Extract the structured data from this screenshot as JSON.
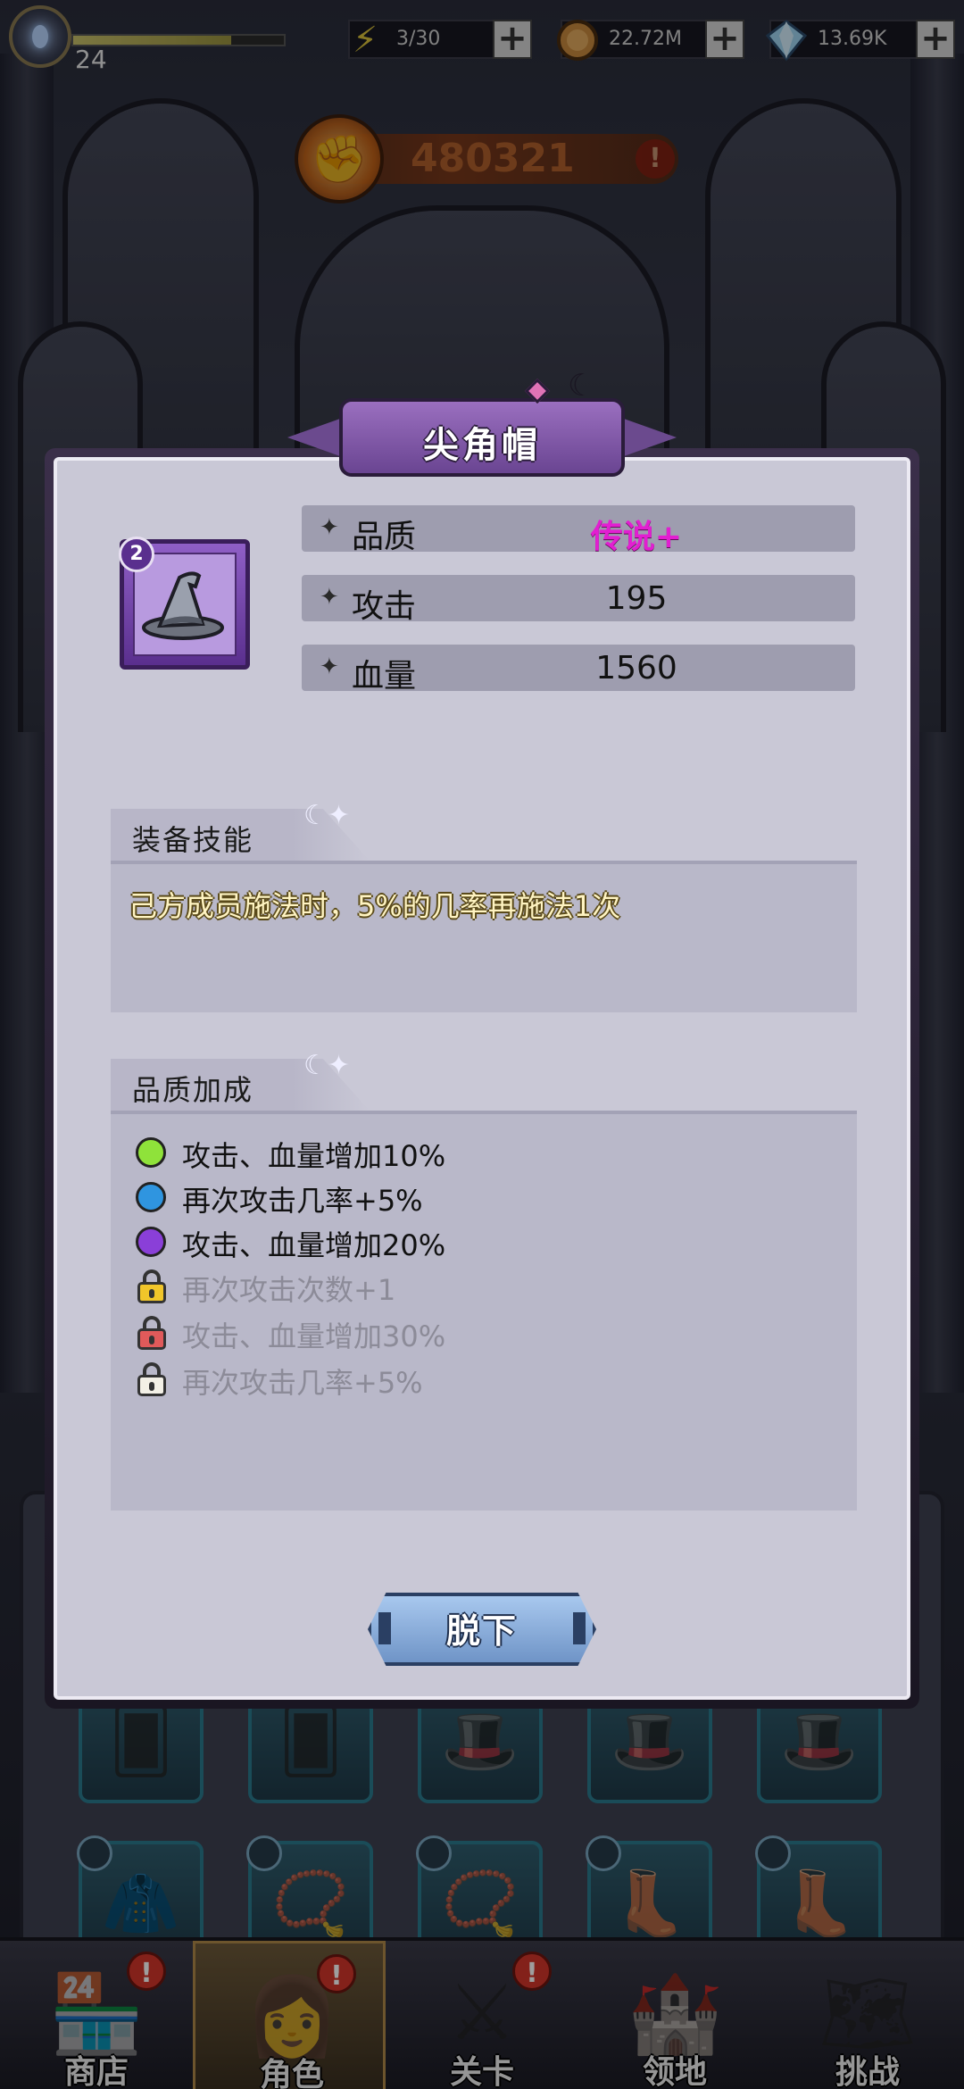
{
  "topbar": {
    "level": "24",
    "xp_fraction": 0.75,
    "stamina": "3/30",
    "gold": "22.72M",
    "gems": "13.69K"
  },
  "power": {
    "value": "480321"
  },
  "popup": {
    "title": "尖角帽",
    "item_badge": "2",
    "stats": [
      {
        "label": "品质",
        "value": "传说+"
      },
      {
        "label": "攻击",
        "value": "195"
      },
      {
        "label": "血量",
        "value": "1560"
      }
    ],
    "skill_section": {
      "title": "装备技能",
      "text": "己方成员施法时，5%的几率再施法1次"
    },
    "quality_section": {
      "title": "品质加成",
      "bonuses": [
        {
          "text": "攻击、血量增加10%",
          "state": "unlocked",
          "color": "#8fe23a"
        },
        {
          "text": "再次攻击几率+5%",
          "state": "unlocked",
          "color": "#2f95e0"
        },
        {
          "text": "攻击、血量增加20%",
          "state": "unlocked",
          "color": "#8a3fd8"
        },
        {
          "text": "再次攻击次数+1",
          "state": "locked",
          "color": "#f1c62a"
        },
        {
          "text": "攻击、血量增加30%",
          "state": "locked",
          "color": "#e05a5a"
        },
        {
          "text": "再次攻击几率+5%",
          "state": "locked",
          "color": "#f3f0e6"
        }
      ]
    },
    "unequip_label": "脱下"
  },
  "bottom_nav": [
    {
      "label": "商店",
      "icon": "shop-icon",
      "badge": "!"
    },
    {
      "label": "角色",
      "icon": "character-icon",
      "badge": "!",
      "active": true
    },
    {
      "label": "关卡",
      "icon": "swords-icon",
      "badge": "!"
    },
    {
      "label": "领地",
      "icon": "castle-icon",
      "badge": ""
    },
    {
      "label": "挑战",
      "icon": "map-scroll-icon",
      "badge": ""
    }
  ],
  "colors": {
    "legend_quality": "#e21fd1",
    "popup_bg": "#c9c8d6",
    "title_plate": "#7d55a8"
  }
}
